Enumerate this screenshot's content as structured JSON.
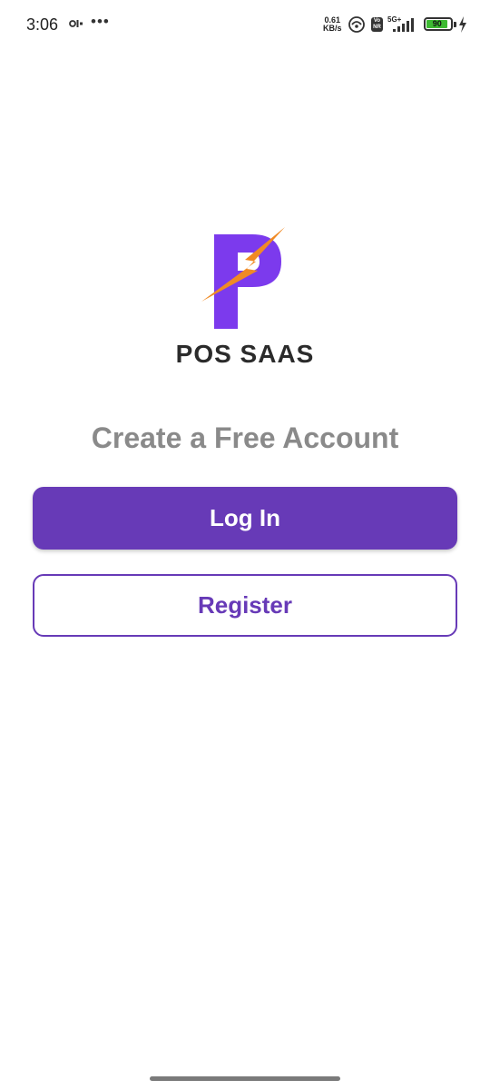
{
  "status_bar": {
    "time": "3:06",
    "notification_icon": "activity-icon",
    "more_icon": "more-dots-icon",
    "more_label": "•••",
    "net_speed_value": "0.61",
    "net_speed_unit": "KB/s",
    "hotspot_icon": "hotspot-icon",
    "volte_label_top": "Vo",
    "volte_label_bottom": "NR",
    "network_type": "5G+",
    "signal_icon": "signal-icon",
    "battery_level": "90",
    "battery_fraction": 0.9,
    "charging_icon": "bolt-icon"
  },
  "brand": {
    "logo_icon": "pos-saas-logo",
    "name": "POS SAAS",
    "colors": {
      "purple": "#7c3aed",
      "orange": "#f08a24"
    }
  },
  "main": {
    "heading": "Create a Free Account",
    "login_label": "Log In",
    "register_label": "Register",
    "accent_color": "#673ab7"
  }
}
